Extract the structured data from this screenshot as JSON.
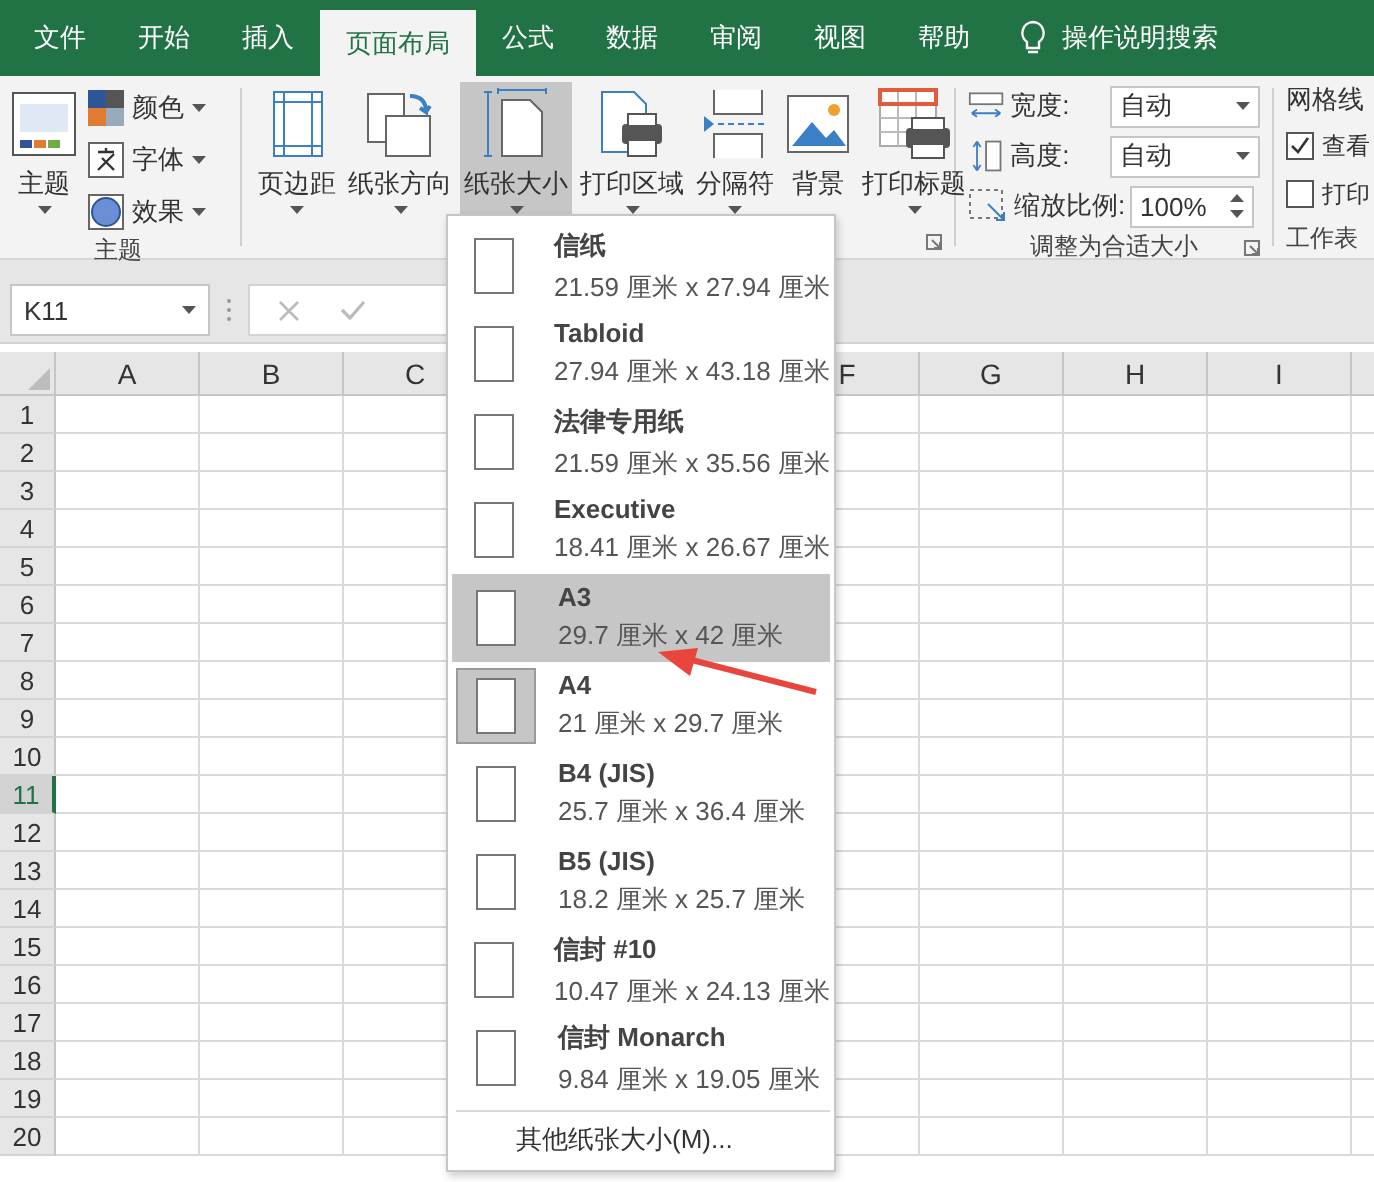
{
  "tabs": [
    {
      "label": "文件",
      "selected": false
    },
    {
      "label": "开始",
      "selected": false
    },
    {
      "label": "插入",
      "selected": false
    },
    {
      "label": "页面布局",
      "selected": true
    },
    {
      "label": "公式",
      "selected": false
    },
    {
      "label": "数据",
      "selected": false
    },
    {
      "label": "审阅",
      "selected": false
    },
    {
      "label": "视图",
      "selected": false
    },
    {
      "label": "帮助",
      "selected": false
    }
  ],
  "tell_me": {
    "placeholder": "操作说明搜索"
  },
  "ribbon": {
    "theme_group": {
      "label": "主题",
      "big_button": "主题",
      "items": [
        {
          "kind": "colors",
          "label": "颜色"
        },
        {
          "kind": "fonts",
          "label": "字体"
        },
        {
          "kind": "effects",
          "label": "效果"
        }
      ]
    },
    "page_setup_group": {
      "buttons": [
        {
          "kind": "margins",
          "label": "页边距",
          "pressed": false
        },
        {
          "kind": "orientation",
          "label": "纸张方向",
          "pressed": false
        },
        {
          "kind": "size",
          "label": "纸张大小",
          "pressed": true
        },
        {
          "kind": "print_area",
          "label": "打印区域",
          "pressed": false
        },
        {
          "kind": "breaks",
          "label": "分隔符",
          "pressed": false
        },
        {
          "kind": "background",
          "label": "背景",
          "pressed": false
        },
        {
          "kind": "print_titles",
          "label": "打印标题",
          "pressed": false
        }
      ]
    },
    "scale_group": {
      "label": "调整为合适大小",
      "fields": [
        {
          "kind": "width",
          "label": "宽度:",
          "value": "自动"
        },
        {
          "kind": "height",
          "label": "高度:",
          "value": "自动"
        },
        {
          "kind": "scale",
          "label": "缩放比例:",
          "value": "100%"
        }
      ]
    },
    "sheet_options_group": {
      "title": "网格线",
      "label": "工作表",
      "checks": [
        {
          "label": "查看",
          "checked": true
        },
        {
          "label": "打印",
          "checked": false
        }
      ]
    }
  },
  "name_box": {
    "value": "K11"
  },
  "columns": [
    "A",
    "B",
    "C",
    "F",
    "G",
    "H",
    "I"
  ],
  "rows": [
    {
      "label": "1",
      "selected": false
    },
    {
      "label": "2",
      "selected": false
    },
    {
      "label": "3",
      "selected": false
    },
    {
      "label": "4",
      "selected": false
    },
    {
      "label": "5",
      "selected": false
    },
    {
      "label": "6",
      "selected": false
    },
    {
      "label": "7",
      "selected": false
    },
    {
      "label": "8",
      "selected": false
    },
    {
      "label": "9",
      "selected": false
    },
    {
      "label": "10",
      "selected": false
    },
    {
      "label": "11",
      "selected": true
    },
    {
      "label": "12",
      "selected": false
    },
    {
      "label": "13",
      "selected": false
    },
    {
      "label": "14",
      "selected": false
    },
    {
      "label": "15",
      "selected": false
    },
    {
      "label": "16",
      "selected": false
    },
    {
      "label": "17",
      "selected": false
    },
    {
      "label": "18",
      "selected": false
    },
    {
      "label": "19",
      "selected": false
    },
    {
      "label": "20",
      "selected": false
    }
  ],
  "paper_menu": {
    "items": [
      {
        "name": "信纸",
        "size": "21.59 厘米 x 27.94 厘米",
        "selected": false,
        "hovered": false
      },
      {
        "name": "Tabloid",
        "size": "27.94 厘米 x 43.18 厘米",
        "selected": false,
        "hovered": false
      },
      {
        "name": "法律专用纸",
        "size": "21.59 厘米 x 35.56 厘米",
        "selected": false,
        "hovered": false
      },
      {
        "name": "Executive",
        "size": "18.41 厘米 x 26.67 厘米",
        "selected": false,
        "hovered": false
      },
      {
        "name": "A3",
        "size": "29.7 厘米 x 42 厘米",
        "selected": false,
        "hovered": true
      },
      {
        "name": "A4",
        "size": "21 厘米 x 29.7 厘米",
        "selected": true,
        "hovered": false
      },
      {
        "name": "B4 (JIS)",
        "size": "25.7 厘米 x 36.4 厘米",
        "selected": false,
        "hovered": false
      },
      {
        "name": "B5 (JIS)",
        "size": "18.2 厘米 x 25.7 厘米",
        "selected": false,
        "hovered": false
      },
      {
        "name": "信封 #10",
        "size": "10.47 厘米 x 24.13 厘米",
        "selected": false,
        "hovered": false
      },
      {
        "name": "信封 Monarch",
        "size": "9.84 厘米 x 19.05 厘米",
        "selected": false,
        "hovered": false
      }
    ],
    "more": "其他纸张大小(M)..."
  },
  "annotation": {
    "kind": "arrow"
  }
}
